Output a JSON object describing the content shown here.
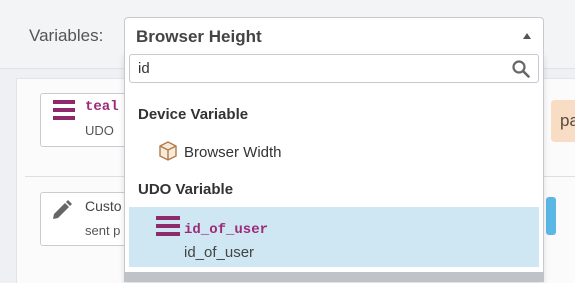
{
  "header": {
    "variables_label": "Variables:"
  },
  "select": {
    "value": "Browser Height"
  },
  "search": {
    "value": "id",
    "placeholder": ""
  },
  "groups": [
    {
      "label": "Device Variable",
      "options": [
        {
          "label": "Browser Width",
          "icon": "cube-icon"
        }
      ]
    },
    {
      "label": "UDO Variable",
      "options": [
        {
          "title": "id_of_user",
          "subtitle": "id_of_user",
          "icon": "udo-stack-icon",
          "selected": true
        }
      ]
    }
  ],
  "background_cards": [
    {
      "title": "teal",
      "subtitle": "UDO",
      "icon": "udo-stack-icon"
    },
    {
      "title": "Custo",
      "subtitle": "sent p",
      "icon": "pencil-icon"
    }
  ],
  "right_badge": {
    "text": "pa"
  },
  "colors": {
    "udo_purple": "#9c2a7a",
    "selected_bg": "#cfe7f2",
    "badge_bg": "#f8dcc4",
    "blue_edge": "#5bb7e6"
  }
}
